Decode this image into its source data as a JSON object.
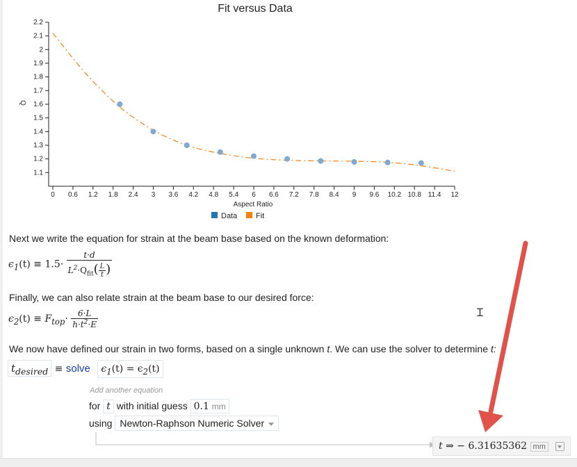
{
  "chart_data": {
    "type": "scatter",
    "title": "Fit versus Data",
    "xlabel": "Aspect Ratio",
    "ylabel": "Q",
    "xlim": [
      0,
      12
    ],
    "ylim": [
      1.0,
      2.2
    ],
    "xticks": [
      "0",
      "0.6",
      "1.2",
      "1.8",
      "2.4",
      "3",
      "3.6",
      "4.2",
      "4.8",
      "5.4",
      "6",
      "6.6",
      "7.2",
      "7.8",
      "8.4",
      "9",
      "9.6",
      "10.2",
      "10.8",
      "11.4",
      "12"
    ],
    "yticks": [
      "1.1",
      "1.2",
      "1.3",
      "1.4",
      "1.5",
      "1.6",
      "1.7",
      "1.8",
      "1.9",
      "2",
      "2.1",
      "2.2"
    ],
    "legend_position": "bottom",
    "series": [
      {
        "name": "Data",
        "kind": "points",
        "color": "#7fa9d2",
        "legend_color": "#1f77b4",
        "x": [
          2,
          3,
          4,
          5,
          6,
          7,
          8,
          9,
          10,
          11
        ],
        "y": [
          1.6,
          1.4,
          1.3,
          1.25,
          1.22,
          1.2,
          1.185,
          1.178,
          1.174,
          1.17
        ]
      },
      {
        "name": "Fit",
        "kind": "dashed-line",
        "color": "#ff7f0e",
        "x": [
          0,
          1,
          2,
          3,
          4,
          5,
          6,
          7,
          8,
          9,
          10,
          11,
          12
        ],
        "y": [
          2.12,
          1.82,
          1.58,
          1.41,
          1.3,
          1.24,
          1.205,
          1.19,
          1.185,
          1.183,
          1.175,
          1.15,
          1.11
        ]
      }
    ]
  },
  "text1": "Next we write the equation for strain at the beam base based on the known deformation:",
  "text2": "Finally, we can also relate strain at the beam base to our desired force:",
  "text3_pre": "We now have defined our strain in two forms, based on a single unknown ",
  "text3_var": "t",
  "text3_post": ".  We can use the solver to determine ",
  "text3_end": "t:",
  "eq1": {
    "lhs": "ϵ",
    "lhs_sub": "1",
    "lhs_arg": "(t)",
    "def": "≡",
    "coef": "1.5·",
    "num": "t·d",
    "den_pre": "L",
    "den_exp": "2",
    "den_mid": "·Q",
    "den_sub": "fit",
    "inner_num": "L",
    "inner_den": "t"
  },
  "eq2": {
    "lhs": "ϵ",
    "lhs_sub": "2",
    "lhs_arg": "(t)",
    "def": "≡",
    "F": "F",
    "F_sub": "top",
    "dot": "·",
    "num": "6·L",
    "den_pre": "h·t",
    "den_exp": "2",
    "den_post": "·E"
  },
  "solver": {
    "var": "t",
    "var_sub": "desired",
    "def": "≡",
    "solve_kw": "solve",
    "eq_left": "ϵ",
    "eq_left_sub": "1",
    "eq_mid": "(t) = ϵ",
    "eq_right_sub": "2",
    "eq_end": "(t)",
    "add_hint": "Add another equation",
    "for_label": "for",
    "for_var": "t",
    "guess_label": "with initial guess",
    "guess_value": "0.1",
    "guess_unit": "mm",
    "using_label": "using",
    "method": "Newton-Raphson Numeric Solver"
  },
  "result": {
    "var": "t",
    "arrow": "⇒",
    "value": "− 6.31635362",
    "unit": "mm"
  },
  "colors": {
    "annotation_arrow": "#e0524a"
  }
}
